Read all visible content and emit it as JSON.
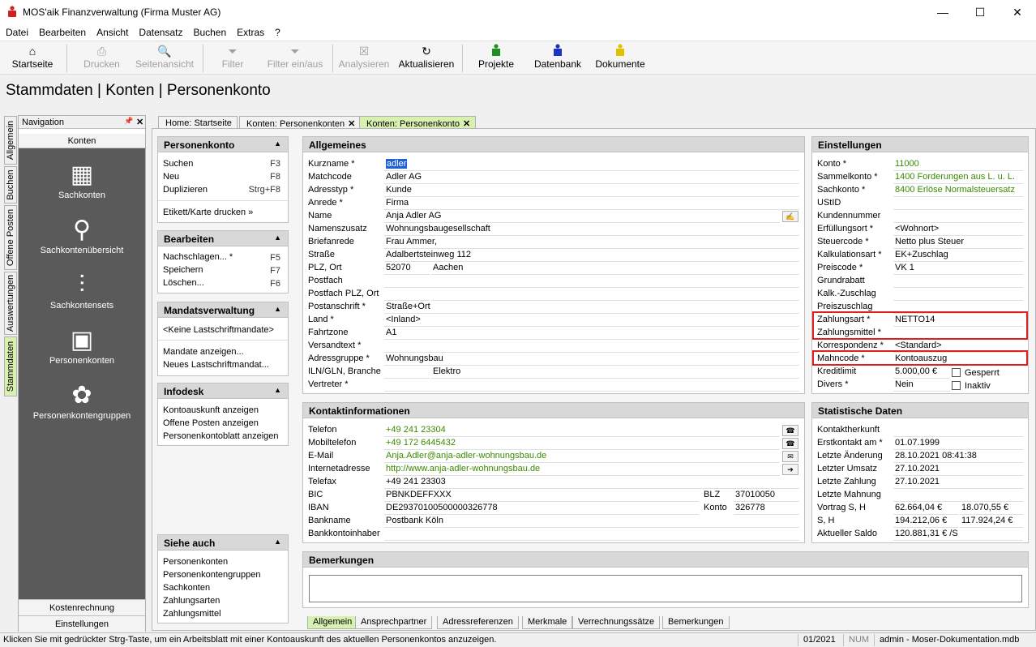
{
  "window": {
    "title": "MOS'aik Finanzverwaltung (Firma Muster AG)",
    "min": "—",
    "max": "☐",
    "close": "✕"
  },
  "menu": [
    "Datei",
    "Bearbeiten",
    "Ansicht",
    "Datensatz",
    "Buchen",
    "Extras",
    "?"
  ],
  "toolbar": {
    "startseite": "Startseite",
    "drucken": "Drucken",
    "seitenansicht": "Seitenansicht",
    "filter": "Filter",
    "filter_toggle": "Filter ein/aus",
    "analysieren": "Analysieren",
    "aktualisieren": "Aktualisieren",
    "projekte": "Projekte",
    "datenbank": "Datenbank",
    "dokumente": "Dokumente"
  },
  "page_title": "Stammdaten | Konten | Personenkonto",
  "vtabs": [
    "Allgemein",
    "Buchen",
    "Offene Posten",
    "Auswertungen",
    "Stammdaten"
  ],
  "nav": {
    "header": "Navigation",
    "pin": "📌",
    "close": "✕",
    "section": "Konten",
    "items": [
      "Sachkonten",
      "Sachkontenübersicht",
      "Sachkontensets",
      "Personenkonten",
      "Personenkontengruppen"
    ],
    "bottom": [
      "Kostenrechnung",
      "Einstellungen"
    ]
  },
  "doctabs": {
    "home": "Home: Startseite",
    "t2": "Konten: Personenkonten",
    "t3": "Konten: Personenkonto",
    "x": "✕"
  },
  "side": {
    "personenkonto": {
      "title": "Personenkonto",
      "items": [
        {
          "label": "Suchen",
          "key": "F3"
        },
        {
          "label": "Neu",
          "key": "F8"
        },
        {
          "label": "Duplizieren",
          "key": "Strg+F8"
        }
      ],
      "extra": "Etikett/Karte drucken »"
    },
    "bearbeiten": {
      "title": "Bearbeiten",
      "items": [
        {
          "label": "Nachschlagen... *",
          "key": "F5"
        },
        {
          "label": "Speichern",
          "key": "F7"
        },
        {
          "label": "Löschen...",
          "key": "F6"
        }
      ]
    },
    "mandat": {
      "title": "Mandatsverwaltung",
      "none": "<Keine Lastschriftmandate>",
      "items": [
        "Mandate anzeigen...",
        "Neues Lastschriftmandat..."
      ]
    },
    "infodesk": {
      "title": "Infodesk",
      "items": [
        "Kontoauskunft anzeigen",
        "Offene Posten anzeigen",
        "Personenkontoblatt anzeigen"
      ]
    },
    "siehe": {
      "title": "Siehe auch",
      "items": [
        "Personenkonten",
        "Personenkontengruppen",
        "Sachkonten",
        "Zahlungsarten",
        "Zahlungsmittel"
      ]
    }
  },
  "allgemeines": {
    "title": "Allgemeines",
    "rows": [
      {
        "label": "Kurzname *",
        "value": "adler"
      },
      {
        "label": "Matchcode",
        "value": "Adler AG"
      },
      {
        "label": "Adresstyp *",
        "value": "Kunde"
      },
      {
        "label": "Anrede *",
        "value": "Firma"
      },
      {
        "label": "Name",
        "value": "Anja Adler AG"
      },
      {
        "label": "Namenszusatz",
        "value": "Wohnungsbaugesellschaft"
      },
      {
        "label": "Briefanrede",
        "value": " Frau Ammer,"
      },
      {
        "label": "Straße",
        "value": "Adalbertsteinweg 112"
      },
      {
        "label": "PLZ, Ort",
        "value": "52070",
        "value2": "Aachen"
      },
      {
        "label": "Postfach",
        "value": ""
      },
      {
        "label": "Postfach PLZ, Ort",
        "value": "",
        "value2": ""
      },
      {
        "label": "Postanschrift *",
        "value": "Straße+Ort"
      },
      {
        "label": "Land *",
        "value": "<Inland>"
      },
      {
        "label": "Fahrtzone",
        "value": "A1"
      },
      {
        "label": "Versandtext *",
        "value": ""
      },
      {
        "label": "Adressgruppe *",
        "value": "Wohnungsbau"
      },
      {
        "label": "ILN/GLN, Branche",
        "value": "",
        "value2": "Elektro"
      },
      {
        "label": "Vertreter *",
        "value": ""
      }
    ]
  },
  "einstellungen": {
    "title": "Einstellungen",
    "rows": [
      {
        "label": "Konto *",
        "value": "11000"
      },
      {
        "label": "Sammelkonto *",
        "value": "1400 Forderungen aus L. u. L."
      },
      {
        "label": "Sachkonto *",
        "value": "8400 Erlöse Normalsteuersatz"
      },
      {
        "label": "UStID",
        "value": ""
      },
      {
        "label": "Kundennummer",
        "value": ""
      },
      {
        "label": "Erfüllungsort *",
        "value": "<Wohnort>"
      },
      {
        "label": "Steuercode *",
        "value": "Netto plus Steuer"
      },
      {
        "label": "Kalkulationsart *",
        "value": "EK+Zuschlag"
      },
      {
        "label": "Preiscode *",
        "value": "VK 1"
      },
      {
        "label": "Grundrabatt",
        "value": ""
      },
      {
        "label": "Kalk.-Zuschlag",
        "value": ""
      },
      {
        "label": "Preiszuschlag",
        "value": ""
      },
      {
        "label": "Zahlungsart *",
        "value": "NETTO14"
      },
      {
        "label": "Zahlungsmittel *",
        "value": ""
      },
      {
        "label": "Korrespondenz *",
        "value": "<Standard>"
      },
      {
        "label": "Mahncode *",
        "value": "Kontoauszug"
      },
      {
        "label": "Kreditlimit",
        "value": "5.000,00 €"
      },
      {
        "label": "Divers *",
        "value": "Nein"
      }
    ],
    "gesperrt": "Gesperrt",
    "inaktiv": "Inaktiv"
  },
  "kontakt": {
    "title": "Kontaktinformationen",
    "rows": [
      {
        "label": "Telefon",
        "value": "+49 241 23304"
      },
      {
        "label": "Mobiltelefon",
        "value": "+49 172 6445432"
      },
      {
        "label": "E-Mail",
        "value": "Anja.Adler@anja-adler-wohnungsbau.de"
      },
      {
        "label": "Internetadresse",
        "value": "http://www.anja-adler-wohnungsbau.de"
      },
      {
        "label": "Telefax",
        "value": "+49 241 23303"
      },
      {
        "label": "BIC",
        "value": "PBNKDEFFXXX",
        "label2": "BLZ",
        "value2": "37010050"
      },
      {
        "label": "IBAN",
        "value": "DE29370100500000326778",
        "label2": "Konto",
        "value2": "326778"
      },
      {
        "label": "Bankname",
        "value": "Postbank Köln"
      },
      {
        "label": "Bankkontoinhaber",
        "value": ""
      }
    ]
  },
  "statistik": {
    "title": "Statistische Daten",
    "rows": [
      {
        "label": "Kontaktherkunft",
        "value": ""
      },
      {
        "label": "Erstkontakt am *",
        "value": "01.07.1999"
      },
      {
        "label": "Letzte Änderung",
        "value": "28.10.2021 08:41:38"
      },
      {
        "label": "Letzter Umsatz",
        "value": "27.10.2021"
      },
      {
        "label": "Letzte Zahlung",
        "value": "27.10.2021"
      },
      {
        "label": "Letzte Mahnung",
        "value": ""
      },
      {
        "label": "Vortrag S, H",
        "value": "62.664,04 €",
        "value2": "18.070,55 €"
      },
      {
        "label": "S, H",
        "value": "194.212,06 €",
        "value2": "117.924,24 €"
      },
      {
        "label": "Aktueller Saldo",
        "value": "120.881,31 € /S"
      }
    ]
  },
  "bemerkungen": {
    "title": "Bemerkungen"
  },
  "bottomtabs": [
    "Allgemein",
    "Ansprechpartner",
    "Adressreferenzen",
    "Merkmale",
    "Verrechnungssätze",
    "Bemerkungen"
  ],
  "status": {
    "hint": "Klicken Sie mit gedrückter Strg-Taste, um ein Arbeitsblatt mit einer Kontoauskunft des aktuellen Personenkontos anzuzeigen.",
    "period": "01/2021",
    "num": "NUM",
    "user": "admin - Moser-Dokumentation.mdb"
  },
  "colors": {
    "accent_green": "#d8f0b0",
    "link_green": "#3a8a00",
    "highlight_red": "#e02020"
  }
}
